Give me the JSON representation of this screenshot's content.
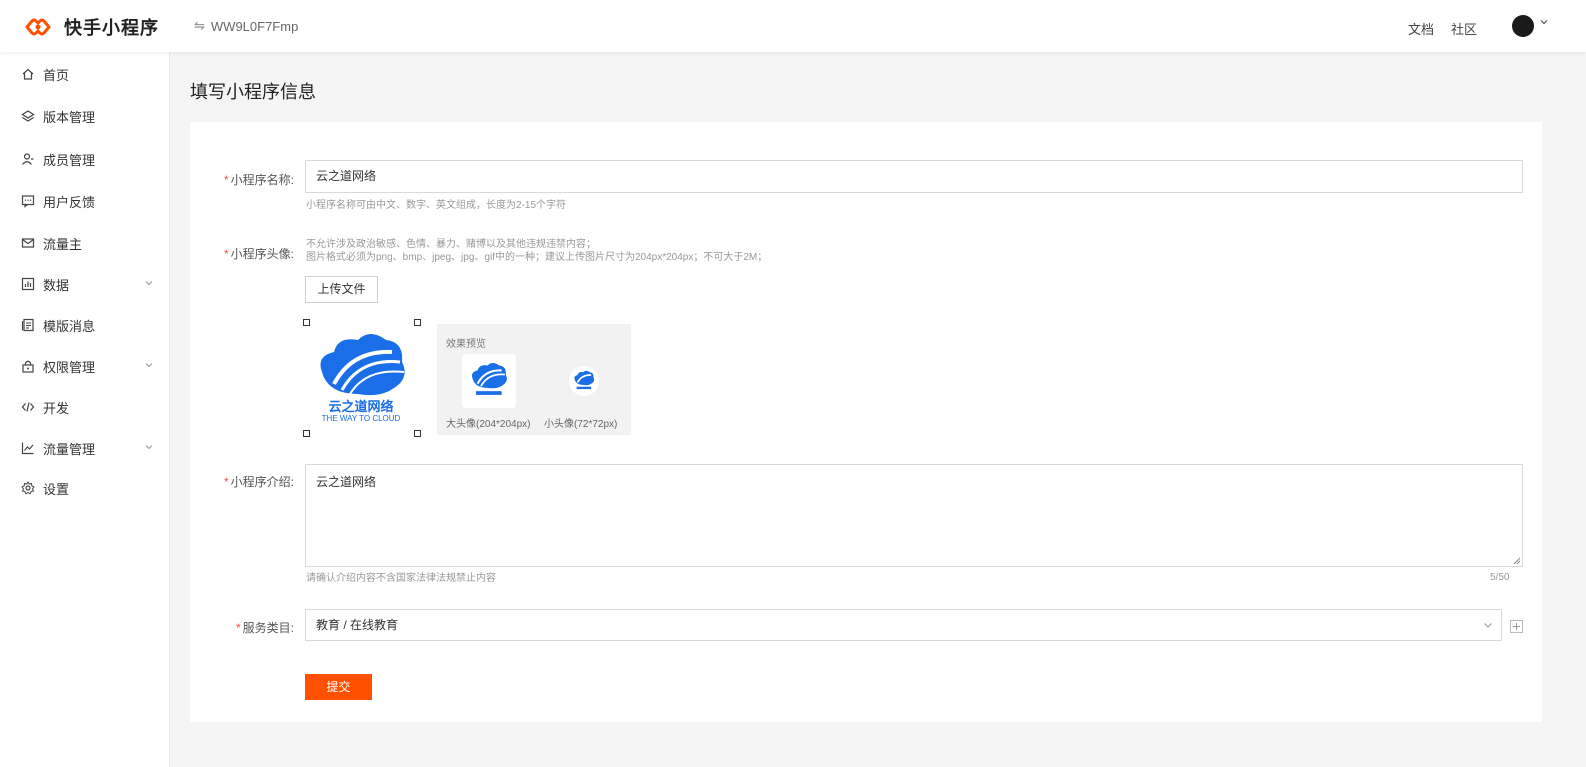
{
  "header": {
    "logo_text": "快手小程序",
    "app_id": "WW9L0F7Fmp",
    "links": [
      "文档",
      "社区"
    ]
  },
  "sidebar": {
    "items": [
      {
        "label": "首页",
        "icon": "home-icon"
      },
      {
        "label": "版本管理",
        "icon": "layers-icon"
      },
      {
        "label": "成员管理",
        "icon": "user-icon"
      },
      {
        "label": "用户反馈",
        "icon": "message-icon"
      },
      {
        "label": "流量主",
        "icon": "mail-icon"
      },
      {
        "label": "数据",
        "icon": "chart-icon",
        "expandable": true
      },
      {
        "label": "模版消息",
        "icon": "template-icon"
      },
      {
        "label": "权限管理",
        "icon": "lock-icon",
        "expandable": true
      },
      {
        "label": "开发",
        "icon": "code-icon"
      },
      {
        "label": "流量管理",
        "icon": "trend-icon",
        "expandable": true
      },
      {
        "label": "设置",
        "icon": "gear-icon"
      }
    ]
  },
  "page": {
    "title": "填写小程序信息"
  },
  "form": {
    "required_mark": "*",
    "name": {
      "label": "小程序名称:",
      "value": "云之道网络",
      "hint": "小程序名称可由中文、数字、英文组成，长度为2-15个字符"
    },
    "avatar": {
      "label": "小程序头像:",
      "hint1": "不允许涉及政治敏感、色情、暴力、赌博以及其他违规违禁内容；",
      "hint2": "图片格式必须为png、bmp、jpeg、jpg、gif中的一种；建议上传图片尺寸为204px*204px；不可大于2M；",
      "upload_label": "上传文件",
      "preview_title": "效果预览",
      "big_caption": "大头像(204*204px)",
      "small_caption": "小头像(72*72px)",
      "logo_text": "云之道网络",
      "logo_subtext": "THE WAY TO CLOUD"
    },
    "intro": {
      "label": "小程序介绍:",
      "value": "云之道网络",
      "hint": "请确认介绍内容不含国家法律法规禁止内容",
      "counter": "5/50"
    },
    "category": {
      "label": "服务类目:",
      "value": "教育 / 在线教育"
    },
    "submit_label": "提交"
  },
  "colors": {
    "brand": "#ff5000",
    "cloud_blue": "#1a6ee8",
    "required": "#ff4d4f"
  }
}
